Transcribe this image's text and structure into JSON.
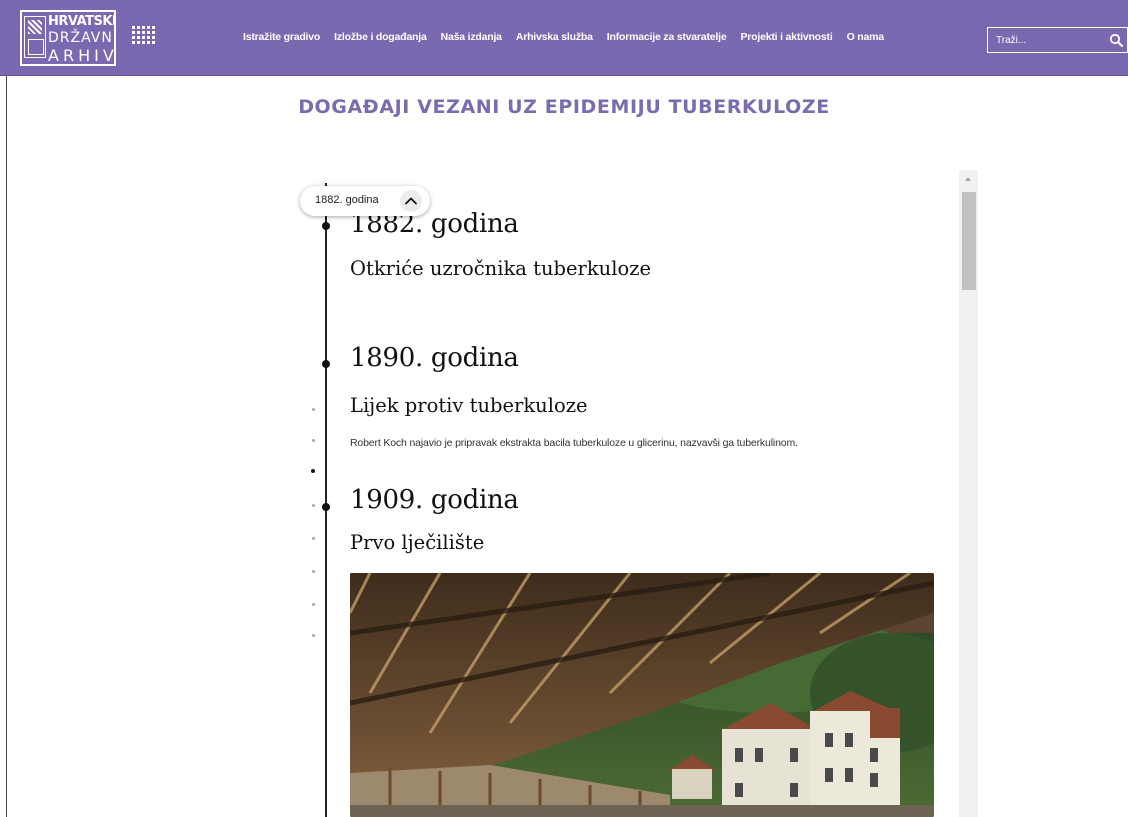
{
  "logo": {
    "line1": "HRVATSKI",
    "line2": "DRŽAVNI",
    "line3": "ARHIV"
  },
  "nav": {
    "items": [
      "Istražite gradivo",
      "Izložbe i događanja",
      "Naša izdanja",
      "Arhivska služba",
      "Informacije za stvaratelje",
      "Projekti i aktivnosti",
      "O nama"
    ]
  },
  "search": {
    "placeholder": "Traži..."
  },
  "page": {
    "title": "DOGAĐAJI VEZANI UZ EPIDEMIJU TUBERKULOZE"
  },
  "tooltip": {
    "label": "1882. godina"
  },
  "events": [
    {
      "year": "1882. godina",
      "title": "Otkriće uzročnika tuberkuloze"
    },
    {
      "year": "1890. godina",
      "title": "Lijek protiv tuberkuloze",
      "description": "Robert Koch najavio je pripravak ekstrakta bacila tuberkuloze u glicerinu, nazvavši ga tuberkulinom."
    },
    {
      "year": "1909. godina",
      "title": "Prvo lječilište"
    }
  ],
  "colors": {
    "header": "#7a68b0",
    "title": "#7b6cb0"
  },
  "icons": {
    "apps": "grid-icon",
    "search": "search-icon",
    "tooltip": "chevron-up-icon",
    "timeline": "dot-icon"
  }
}
